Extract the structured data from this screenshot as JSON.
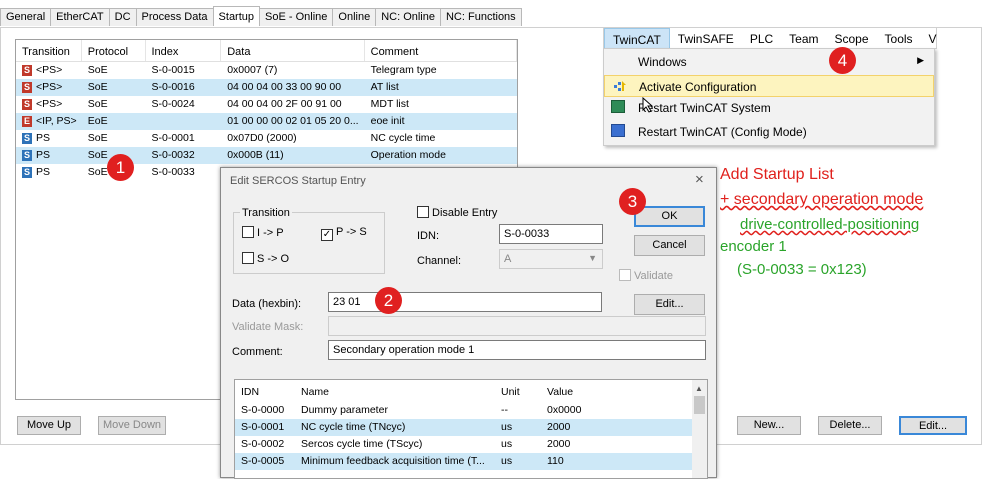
{
  "tabs": [
    "General",
    "EtherCAT",
    "DC",
    "Process Data",
    "Startup",
    "SoE - Online",
    "Online",
    "NC: Online",
    "NC: Functions"
  ],
  "startup_list": {
    "columns": [
      "Transition",
      "Protocol",
      "Index",
      "Data",
      "Comment"
    ],
    "rows": [
      {
        "icon": "S",
        "transition": "<PS>",
        "protocol": "SoE",
        "index": "S-0-0015",
        "data": "0x0007 (7)",
        "comment": "Telegram type",
        "hl": false
      },
      {
        "icon": "S",
        "transition": "<PS>",
        "protocol": "SoE",
        "index": "S-0-0016",
        "data": "04 00 04 00 33 00 90 00",
        "comment": "AT list",
        "hl": true
      },
      {
        "icon": "S",
        "transition": "<PS>",
        "protocol": "SoE",
        "index": "S-0-0024",
        "data": "04 00 04 00 2F 00 91 00",
        "comment": "MDT list",
        "hl": false
      },
      {
        "icon": "E",
        "transition": "<IP, PS>",
        "protocol": "EoE",
        "index": "",
        "data": "01 00 00 00 02 01 05 20 0...",
        "comment": "eoe init",
        "hl": true
      },
      {
        "icon": "S",
        "transition": "PS",
        "protocol": "SoE",
        "index": "S-0-0001",
        "data": "0x07D0 (2000)",
        "comment": "NC cycle time",
        "hl": false
      },
      {
        "icon": "S",
        "transition": "PS",
        "protocol": "SoE",
        "index": "S-0-0032",
        "data": "0x000B (11)",
        "comment": "Operation mode",
        "hl": true
      },
      {
        "icon": "S",
        "transition": "PS",
        "protocol": "SoE",
        "index": "S-0-0033",
        "data": "",
        "comment": "",
        "hl": false
      }
    ]
  },
  "buttons": {
    "move_up": "Move Up",
    "move_down": "Move Down",
    "new": "New...",
    "delete": "Delete...",
    "edit": "Edit..."
  },
  "menubar": [
    "TwinCAT",
    "TwinSAFE",
    "PLC",
    "Team",
    "Scope",
    "Tools",
    "V"
  ],
  "menu_items": [
    "Windows",
    "Activate Configuration",
    "Restart TwinCAT System",
    "Restart TwinCAT (Config Mode)"
  ],
  "dialog": {
    "title": "Edit SERCOS Startup Entry",
    "transition_group": "Transition",
    "ip": "I -> P",
    "ps": "P -> S",
    "so": "S -> O",
    "disable_entry": "Disable Entry",
    "idn_label": "IDN:",
    "idn_value": "S-0-0033",
    "channel_label": "Channel:",
    "channel_value": "A",
    "validate": "Validate",
    "ok": "OK",
    "cancel": "Cancel",
    "edit": "Edit...",
    "data_label": "Data (hexbin):",
    "data_value": "23 01",
    "validate_mask_label": "Validate Mask:",
    "comment_label": "Comment:",
    "comment_value": "Secondary operation mode 1",
    "param_columns": [
      "IDN",
      "Name",
      "Unit",
      "Value"
    ],
    "params": [
      {
        "idn": "S-0-0000",
        "name": "Dummy parameter",
        "unit": "--",
        "value": "0x0000",
        "hl": false
      },
      {
        "idn": "S-0-0001",
        "name": "NC cycle time (TNcyc)",
        "unit": "us",
        "value": "2000",
        "hl": true
      },
      {
        "idn": "S-0-0002",
        "name": "Sercos cycle time (TScyc)",
        "unit": "us",
        "value": "2000",
        "hl": false
      },
      {
        "idn": "S-0-0005",
        "name": "Minimum feedback acquisition time (T...",
        "unit": "us",
        "value": "110",
        "hl": true
      }
    ]
  },
  "annotations": {
    "title": "Add Startup List",
    "line2": "+ secondary operation mode",
    "line3": "drive-controlled-positioning",
    "line4": "encoder 1",
    "line5": "(S-0-0033 = 0x123)"
  },
  "steps": [
    "1",
    "2",
    "3",
    "4"
  ],
  "colors": {
    "annotation_red": "#e0201c",
    "annotation_green": "#2aa42a",
    "selection": "#cde8f7",
    "menu_highlight": "#fdf4bf"
  }
}
